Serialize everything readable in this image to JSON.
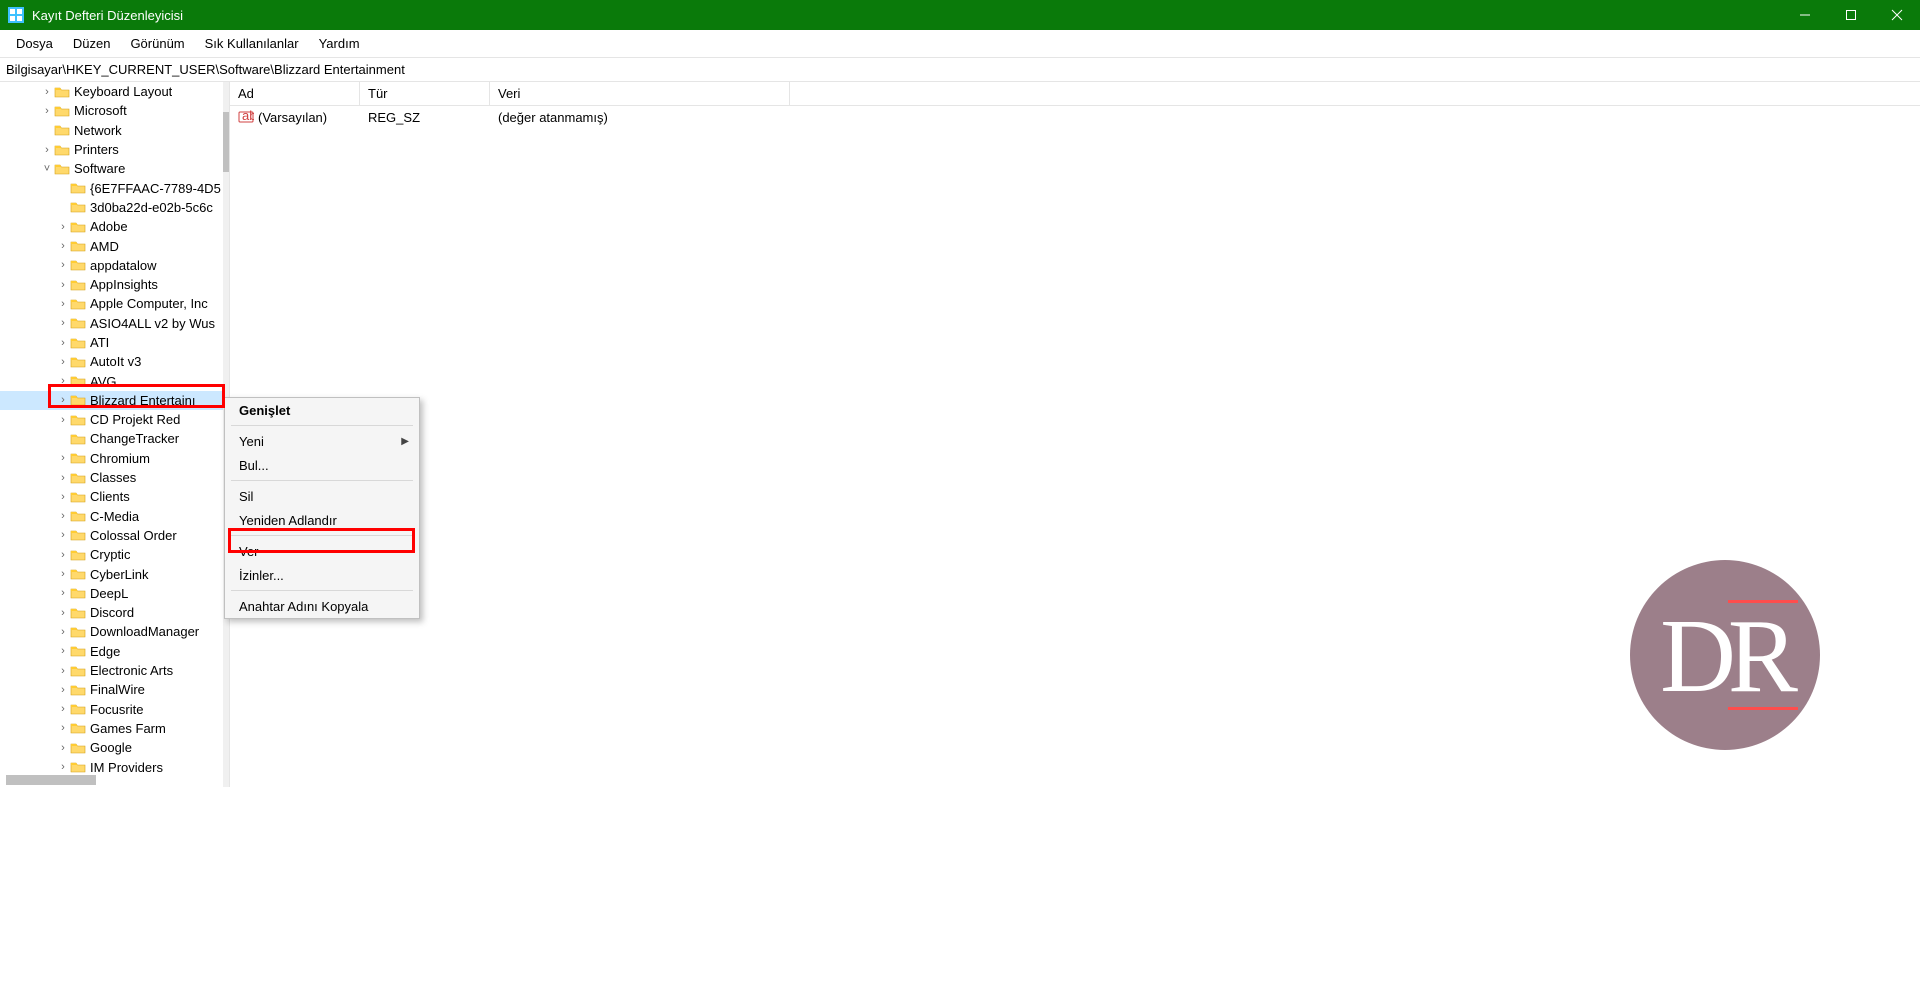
{
  "window": {
    "title": "Kayıt Defteri Düzenleyicisi"
  },
  "menu": {
    "file": "Dosya",
    "edit": "Düzen",
    "view": "Görünüm",
    "favorites": "Sık Kullanılanlar",
    "help": "Yardım"
  },
  "address": "Bilgisayar\\HKEY_CURRENT_USER\\Software\\Blizzard Entertainment",
  "tree": {
    "top_items": [
      {
        "label": "Keyboard Layout",
        "indent": 56,
        "twisty": ">"
      },
      {
        "label": "Microsoft",
        "indent": 56,
        "twisty": ">"
      },
      {
        "label": "Network",
        "indent": 56,
        "twisty": ""
      },
      {
        "label": "Printers",
        "indent": 56,
        "twisty": ">"
      },
      {
        "label": "Software",
        "indent": 56,
        "twisty": "v",
        "expanded": true
      }
    ],
    "software_children": [
      {
        "label": "{6E7FFAAC-7789-4D5",
        "twisty": ""
      },
      {
        "label": "3d0ba22d-e02b-5c6c",
        "twisty": ""
      },
      {
        "label": "Adobe",
        "twisty": ">"
      },
      {
        "label": "AMD",
        "twisty": ">"
      },
      {
        "label": "appdatalow",
        "twisty": ">"
      },
      {
        "label": "AppInsights",
        "twisty": ">"
      },
      {
        "label": "Apple Computer, Inc",
        "twisty": ">"
      },
      {
        "label": "ASIO4ALL v2 by Wus",
        "twisty": ">"
      },
      {
        "label": "ATI",
        "twisty": ">"
      },
      {
        "label": "AutoIt v3",
        "twisty": ">"
      },
      {
        "label": "AVG",
        "twisty": ">"
      },
      {
        "label": "Blizzard Entertainı",
        "twisty": ">",
        "selected": true
      },
      {
        "label": "CD Projekt Red",
        "twisty": ">"
      },
      {
        "label": "ChangeTracker",
        "twisty": ""
      },
      {
        "label": "Chromium",
        "twisty": ">"
      },
      {
        "label": "Classes",
        "twisty": ">"
      },
      {
        "label": "Clients",
        "twisty": ">"
      },
      {
        "label": "C-Media",
        "twisty": ">"
      },
      {
        "label": "Colossal Order",
        "twisty": ">"
      },
      {
        "label": "Cryptic",
        "twisty": ">"
      },
      {
        "label": "CyberLink",
        "twisty": ">"
      },
      {
        "label": "DeepL",
        "twisty": ">"
      },
      {
        "label": "Discord",
        "twisty": ">"
      },
      {
        "label": "DownloadManager",
        "twisty": ">"
      },
      {
        "label": "Edge",
        "twisty": ">"
      },
      {
        "label": "Electronic Arts",
        "twisty": ">"
      },
      {
        "label": "FinalWire",
        "twisty": ">"
      },
      {
        "label": "Focusrite",
        "twisty": ">"
      },
      {
        "label": "Games Farm",
        "twisty": ">"
      },
      {
        "label": "Google",
        "twisty": ">"
      },
      {
        "label": "IM Providers",
        "twisty": ">"
      }
    ]
  },
  "list": {
    "columns": {
      "name": "Ad",
      "type": "Tür",
      "data": "Veri"
    },
    "rows": [
      {
        "name": "(Varsayılan)",
        "type": "REG_SZ",
        "data": "(değer atanmamış)"
      }
    ]
  },
  "context_menu": {
    "expand": "Genişlet",
    "new": "Yeni",
    "find": "Bul...",
    "delete": "Sil",
    "rename": "Yeniden Adlandır",
    "export": "Ver",
    "permissions": "İzinler...",
    "copy_key_name": "Anahtar Adını Kopyala"
  },
  "watermark_text": "DR"
}
